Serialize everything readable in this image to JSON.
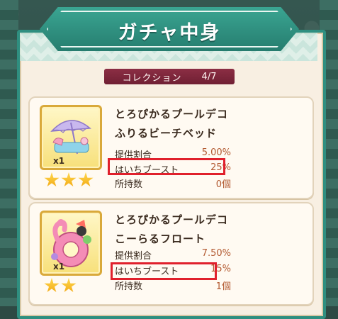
{
  "header": {
    "title": "ガチャ中身"
  },
  "collection": {
    "label": "コレクション",
    "progress": "4/7"
  },
  "items": [
    {
      "name_line1": "とろぴかるプールデコ",
      "name_line2": "ふりるビーチベッド",
      "quantity": "x1",
      "stars": 3,
      "stats": [
        {
          "label": "提供割合",
          "value": "5.00%"
        },
        {
          "label": "はいちブースト",
          "value": "25%"
        },
        {
          "label": "所持数",
          "value": "0個"
        }
      ],
      "highlighted_row": "はいちブースト",
      "icon": "parasol-beach-bed-icon"
    },
    {
      "name_line1": "とろぴかるプールデコ",
      "name_line2": "こーらるフロート",
      "quantity": "x1",
      "stars": 2,
      "stats": [
        {
          "label": "提供割合",
          "value": "7.50%"
        },
        {
          "label": "はいちブースト",
          "value": "15%"
        },
        {
          "label": "所持数",
          "value": "1個"
        }
      ],
      "highlighted_row": "はいちブースト",
      "icon": "flamingo-float-icon"
    }
  ],
  "colors": {
    "frame": "#2f8f80",
    "banner": "#3aa592",
    "collection_bar": "#8c2e44",
    "highlight": "#e0202c",
    "star": "#ffd84d"
  }
}
